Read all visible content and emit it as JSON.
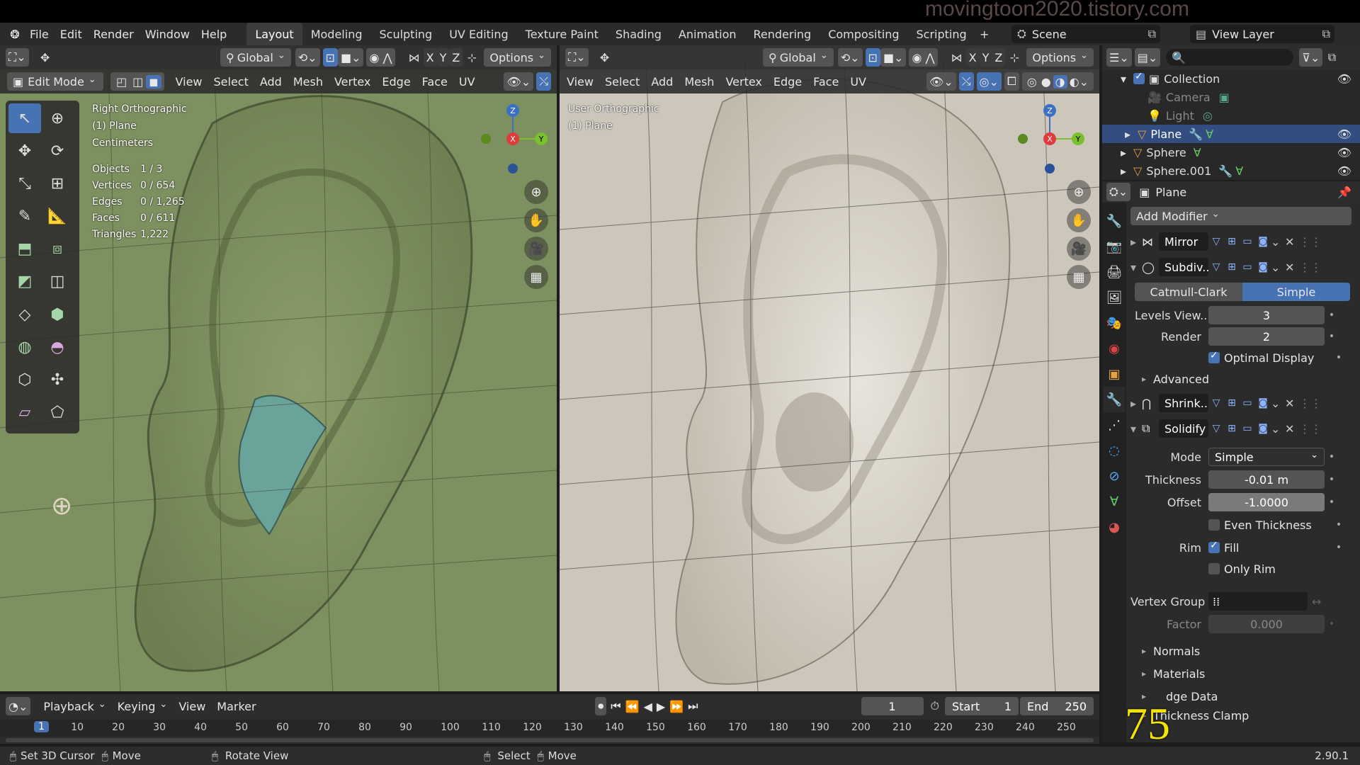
{
  "watermark": "movingtoon2020.tistory.com",
  "menus": [
    "File",
    "Edit",
    "Render",
    "Window",
    "Help"
  ],
  "workspaces": [
    "Layout",
    "Modeling",
    "Sculpting",
    "UV Editing",
    "Texture Paint",
    "Shading",
    "Animation",
    "Rendering",
    "Compositing",
    "Scripting"
  ],
  "scene": "Scene",
  "view_layer": "View Layer",
  "vp_header": {
    "orientation": "Global",
    "options": "Options",
    "x": "X",
    "y": "Y",
    "z": "Z"
  },
  "left_vp": {
    "mode": "Edit Mode",
    "menus": [
      "View",
      "Select",
      "Add",
      "Mesh",
      "Vertex",
      "Edge",
      "Face",
      "UV"
    ],
    "info": {
      "view": "Right Orthographic",
      "object": "(1) Plane",
      "units": "Centimeters"
    },
    "stats": [
      {
        "k": "Objects",
        "v": "1 / 3"
      },
      {
        "k": "Vertices",
        "v": "0 / 654"
      },
      {
        "k": "Edges",
        "v": "0 / 1,265"
      },
      {
        "k": "Faces",
        "v": "0 / 611"
      },
      {
        "k": "Triangles",
        "v": "1,222"
      }
    ]
  },
  "right_vp": {
    "menus": [
      "View",
      "Select",
      "Add",
      "Mesh",
      "Vertex",
      "Edge",
      "Face",
      "UV"
    ],
    "info": {
      "view": "User Orthographic",
      "object": "(1) Plane"
    }
  },
  "outliner": {
    "items": [
      {
        "name": "Collection"
      },
      {
        "name": "Camera"
      },
      {
        "name": "Light"
      },
      {
        "name": "Plane"
      },
      {
        "name": "Sphere"
      },
      {
        "name": "Sphere.001"
      }
    ]
  },
  "props": {
    "object": "Plane",
    "add_modifier": "Add Modifier",
    "mirror": "Mirror",
    "subdiv": "Subdiv...",
    "catmull": "Catmull-Clark",
    "simple": "Simple",
    "levels_label": "Levels View...",
    "levels": "3",
    "render_label": "Render",
    "render": "2",
    "optimal": "Optimal Display",
    "advanced": "Advanced",
    "shrink": "Shrink...",
    "solidify": "Solidify",
    "mode_label": "Mode",
    "mode": "Simple",
    "thickness_label": "Thickness",
    "thickness": "-0.01 m",
    "offset_label": "Offset",
    "offset": "-1.0000",
    "even": "Even Thickness",
    "rim_label": "Rim",
    "fill": "Fill",
    "only_rim": "Only Rim",
    "vgroup_label": "Vertex Group",
    "factor_label": "Factor",
    "factor": "0.000",
    "normals": "Normals",
    "materials": "Materials",
    "edge_data": "dge Data",
    "clamp": "Thickness Clamp"
  },
  "timeline": {
    "playback": "Playback",
    "keying": "Keying",
    "view": "View",
    "marker": "Marker",
    "frame": "1",
    "start_label": "Start",
    "start": "1",
    "end_label": "End",
    "end": "250",
    "ticks": [
      "1",
      "10",
      "20",
      "30",
      "40",
      "50",
      "60",
      "70",
      "80",
      "90",
      "100",
      "110",
      "120",
      "130",
      "140",
      "150",
      "160",
      "170",
      "180",
      "190",
      "200",
      "210",
      "220",
      "230",
      "240",
      "250"
    ]
  },
  "status": {
    "cursor": "Set 3D Cursor",
    "move": "Move",
    "rotate": "Rotate View",
    "select": "Select",
    "move2": "Move",
    "version": "2.90.1"
  },
  "overlay_number": "75",
  "colors": {
    "accent": "#4772b3",
    "header": "#2d2d2d",
    "left_bg": "#7d9060",
    "right_bg": "#c8c2b6"
  }
}
